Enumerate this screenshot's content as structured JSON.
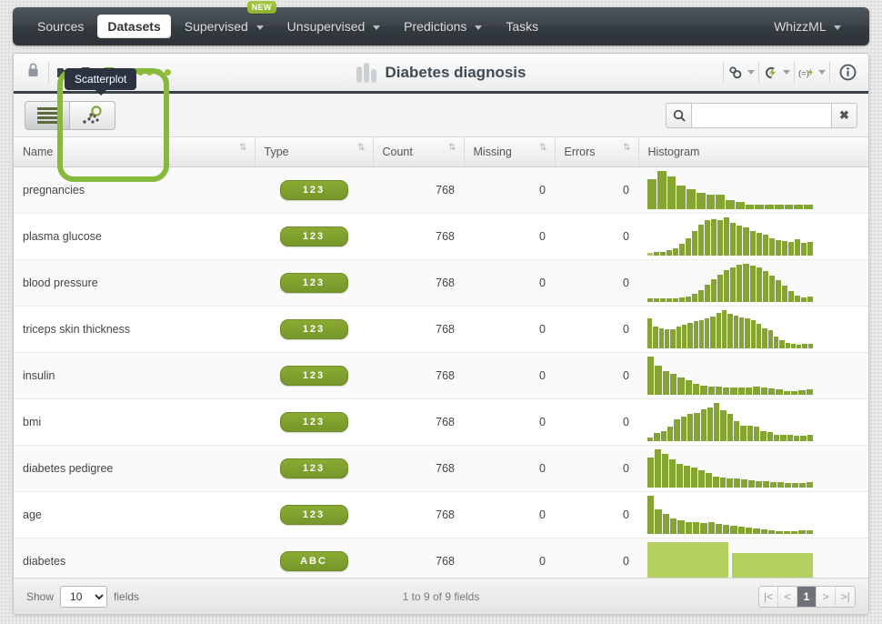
{
  "navbar": {
    "items": [
      {
        "label": "Sources",
        "active": false,
        "caret": false,
        "badge": null
      },
      {
        "label": "Datasets",
        "active": true,
        "caret": false,
        "badge": null
      },
      {
        "label": "Supervised",
        "active": false,
        "caret": true,
        "badge": "NEW"
      },
      {
        "label": "Unsupervised",
        "active": false,
        "caret": true,
        "badge": null
      },
      {
        "label": "Predictions",
        "active": false,
        "caret": true,
        "badge": null
      },
      {
        "label": "Tasks",
        "active": false,
        "caret": false,
        "badge": null
      }
    ],
    "right": {
      "label": "WhizzML",
      "caret": true
    }
  },
  "header": {
    "lock_icon": "lock-icon",
    "title": "Diabetes diagnosis",
    "dataset_icon": "dataset-bars-icon",
    "status_dots": 4,
    "left_icons": [
      "folder-icon",
      "tag-icon"
    ],
    "right_icons": [
      "gears-dropdown-icon",
      "cloud-lightning-icon",
      "formula-lightning-icon",
      "info-icon"
    ]
  },
  "toolbar": {
    "view_list_icon": "list-view-icon",
    "view_scatter_icon": "scatterplot-view-icon",
    "tooltip": "Scatterplot",
    "search_icon": "search-icon",
    "clear_icon": "close-icon",
    "search_value": "",
    "search_placeholder": ""
  },
  "table": {
    "columns": [
      "Name",
      "Type",
      "Count",
      "Missing",
      "Errors",
      "Histogram"
    ],
    "rows": [
      {
        "name": "pregnancies",
        "type": "123",
        "count": "768",
        "missing": "0",
        "errors": "0"
      },
      {
        "name": "plasma glucose",
        "type": "123",
        "count": "768",
        "missing": "0",
        "errors": "0"
      },
      {
        "name": "blood pressure",
        "type": "123",
        "count": "768",
        "missing": "0",
        "errors": "0"
      },
      {
        "name": "triceps skin thickness",
        "type": "123",
        "count": "768",
        "missing": "0",
        "errors": "0"
      },
      {
        "name": "insulin",
        "type": "123",
        "count": "768",
        "missing": "0",
        "errors": "0"
      },
      {
        "name": "bmi",
        "type": "123",
        "count": "768",
        "missing": "0",
        "errors": "0"
      },
      {
        "name": "diabetes pedigree",
        "type": "123",
        "count": "768",
        "missing": "0",
        "errors": "0"
      },
      {
        "name": "age",
        "type": "123",
        "count": "768",
        "missing": "0",
        "errors": "0"
      },
      {
        "name": "diabetes",
        "type": "ABC",
        "count": "768",
        "missing": "0",
        "errors": "0"
      }
    ]
  },
  "histograms": [
    {
      "field": "pregnancies",
      "values": [
        72,
        92,
        78,
        56,
        48,
        40,
        36,
        34,
        22,
        18,
        10,
        10,
        10,
        10,
        10,
        10,
        10
      ]
    },
    {
      "field": "plasma glucose",
      "values": [
        6,
        9,
        10,
        14,
        18,
        30,
        44,
        62,
        78,
        88,
        92,
        88,
        96,
        82,
        76,
        70,
        62,
        56,
        52,
        44,
        38,
        36,
        34,
        40,
        32,
        34
      ],
      "pale_index": 0
    },
    {
      "field": "blood pressure",
      "values": [
        10,
        9,
        9,
        9,
        10,
        11,
        14,
        20,
        30,
        42,
        56,
        68,
        78,
        86,
        92,
        94,
        90,
        84,
        76,
        66,
        54,
        40,
        26,
        16,
        12,
        14
      ]
    },
    {
      "field": "triceps skin thickness",
      "values": [
        76,
        56,
        52,
        50,
        50,
        56,
        60,
        66,
        70,
        72,
        78,
        82,
        92,
        98,
        88,
        84,
        80,
        78,
        72,
        62,
        52,
        46,
        30,
        20,
        14,
        12,
        10,
        12,
        12
      ]
    },
    {
      "field": "insulin",
      "values": [
        96,
        72,
        60,
        52,
        44,
        36,
        28,
        22,
        20,
        20,
        18,
        18,
        18,
        18,
        20,
        18,
        16,
        14,
        10,
        10,
        12,
        14
      ]
    },
    {
      "field": "bmi",
      "values": [
        8,
        18,
        22,
        34,
        50,
        56,
        62,
        64,
        74,
        78,
        88,
        72,
        62,
        46,
        36,
        36,
        34,
        22,
        20,
        14,
        14,
        14,
        12,
        12,
        14
      ]
    },
    {
      "field": "diabetes pedigree",
      "values": [
        72,
        92,
        80,
        68,
        58,
        52,
        48,
        42,
        34,
        26,
        24,
        22,
        22,
        20,
        18,
        16,
        16,
        14,
        14,
        12,
        12,
        12,
        14
      ]
    },
    {
      "field": "age",
      "values": [
        98,
        62,
        52,
        40,
        34,
        30,
        30,
        28,
        30,
        26,
        24,
        22,
        18,
        16,
        14,
        12,
        10,
        8,
        8,
        8,
        10,
        10
      ]
    },
    {
      "field": "diabetes",
      "values": [
        100,
        72
      ],
      "wide": true
    }
  ],
  "footer": {
    "show_label": "Show",
    "show_value": "10",
    "fields_label": "fields",
    "range_text": "1 to 9 of 9 fields",
    "pager": [
      "|<",
      "<",
      "1",
      ">",
      ">|"
    ],
    "current_page": "1"
  },
  "colors": {
    "accent_green": "#85a532",
    "highlight_green": "#86b93c",
    "navbar_dark": "#3d4449",
    "title_color": "#3f4a52"
  }
}
